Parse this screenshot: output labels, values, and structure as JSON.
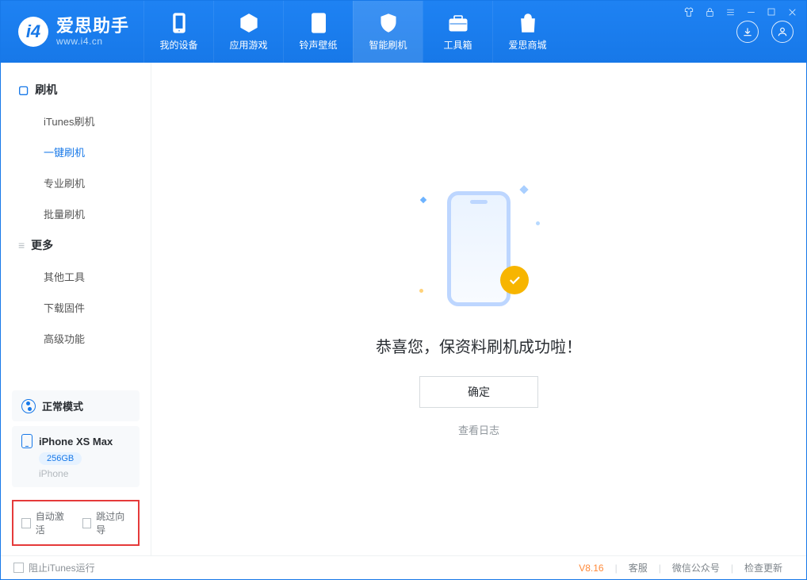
{
  "app": {
    "name": "爱思助手",
    "url": "www.i4.cn"
  },
  "nav": {
    "tabs": [
      {
        "label": "我的设备"
      },
      {
        "label": "应用游戏"
      },
      {
        "label": "铃声壁纸"
      },
      {
        "label": "智能刷机"
      },
      {
        "label": "工具箱"
      },
      {
        "label": "爱思商城"
      }
    ]
  },
  "sidebar": {
    "group1": {
      "title": "刷机",
      "items": [
        {
          "label": "iTunes刷机"
        },
        {
          "label": "一键刷机"
        },
        {
          "label": "专业刷机"
        },
        {
          "label": "批量刷机"
        }
      ]
    },
    "group2": {
      "title": "更多",
      "items": [
        {
          "label": "其他工具"
        },
        {
          "label": "下载固件"
        },
        {
          "label": "高级功能"
        }
      ]
    },
    "mode": "正常模式",
    "device": {
      "name": "iPhone XS Max",
      "storage": "256GB",
      "brand": "iPhone"
    },
    "checks": {
      "auto": "自动激活",
      "skip": "跳过向导"
    }
  },
  "main": {
    "success": "恭喜您，保资料刷机成功啦！",
    "ok": "确定",
    "log": "查看日志"
  },
  "footer": {
    "block": "阻止iTunes运行",
    "version": "V8.16",
    "links": [
      "客服",
      "微信公众号",
      "检查更新"
    ]
  }
}
